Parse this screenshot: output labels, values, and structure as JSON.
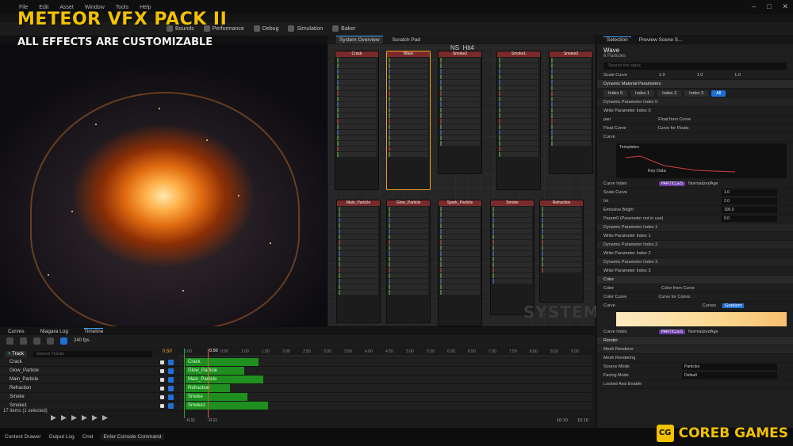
{
  "overlay": {
    "title": "METEOR VFX PACK II",
    "subtitle": "ALL EFFECTS ARE CUSTOMIZABLE"
  },
  "menubar": [
    "File",
    "Edit",
    "Asset",
    "Window",
    "Tools",
    "Help"
  ],
  "toolbar": {
    "bounds": "Bounds",
    "performance": "Performance",
    "debug": "Debug",
    "simulation": "Simulation",
    "baker": "Baker"
  },
  "graph": {
    "tabs": [
      "System Overview",
      "Scratch Pad"
    ],
    "system_name": "NS_Hit4",
    "watermark": "SYSTEM",
    "top_nodes": [
      "Crack",
      "Wave",
      "Smoke2",
      "Smoke1",
      "Smoke3"
    ],
    "bottom_nodes": [
      "Main_Particle",
      "Glow_Particle",
      "Spark_Particle",
      "Smoke",
      "Refraction"
    ]
  },
  "details": {
    "tabs": [
      "Selection",
      "Preview Scene S..."
    ],
    "name": "Wave",
    "subtitle": "6 Particles",
    "search_placeholder": "Search the stack",
    "scale_curve": "Scale Curve",
    "dynamic_params": "Dynamic Material Parameters",
    "index_pills": [
      "Index 0",
      "Index 1",
      "Index 2",
      "Index 3",
      "All"
    ],
    "dyn_index0": "Dynamic Parameter Index 0",
    "write_index0": "Write Parameter Index 0",
    "param_0": "pari",
    "float_from_curve": "Float from Curve",
    "float_curve": "Float Curve",
    "curve_for_floats": "Curve for Floats",
    "curve": "Curve",
    "templates": "Templates",
    "key_data": "Key Data",
    "curve_index": "Curve Index",
    "particles_tag": "PARTICLES",
    "normalized_age": "NormalizedAge",
    "scale_curve_value": "1.0",
    "rows_values": [
      {
        "label": "Int",
        "value": "2.0"
      },
      {
        "label": "Emissive Bright",
        "value": "100.0"
      },
      {
        "label": "Param0 (Parameter not in use)",
        "value": "0.0"
      }
    ],
    "dyn_index1": "Dynamic Parameter Index 1",
    "write_index1": "Write Parameter Index 1",
    "dyn_index2": "Dynamic Parameter Index 2",
    "write_index2": "Write Parameter Index 2",
    "dyn_index3": "Dynamic Parameter Index 3",
    "write_index3": "Write Parameter Index 3",
    "color_section": "Color",
    "color_label": "Color",
    "color_from_curve": "Color from Curve",
    "color_curve": "Color Curve",
    "curve_for_colors": "Curve for Colors",
    "curves_tab": "Curves",
    "gradient_tab": "Gradient",
    "render_section": "Render",
    "mesh_renderer": "Mesh Renderer",
    "mesh_rendering": "Mesh Rendering",
    "source_mode": "Source Mode",
    "source_mode_val": "Particles",
    "facing_mode": "Facing Mode",
    "facing_mode_val": "Default",
    "locked_axis": "Locked Axis Enable",
    "xyz": {
      "x": "1.0",
      "y": "1.0",
      "z": "1.0"
    }
  },
  "bottom": {
    "tabs": [
      "Curves",
      "Niagara Log",
      "Timeline"
    ],
    "fps": "240 fps",
    "add_track": "Track",
    "search_tracks": "Search Tracks",
    "playhead_value": "0.50",
    "left_start": "0.00",
    "ruler_labels": [
      "0.00",
      "0.50",
      "1.00",
      "1.50",
      "2.00",
      "2.50",
      "3.00",
      "3.50",
      "4.00",
      "4.50",
      "5.00",
      "5.50",
      "6.00",
      "6.50",
      "7.00",
      "7.50",
      "8.00",
      "8.50",
      "9.00",
      "9.50"
    ],
    "tracks": [
      "Crack",
      "Glow_Particle",
      "Main_Particle",
      "Refraction",
      "Smoke",
      "Smoke1"
    ],
    "count": "17 items (1 selected)",
    "foot_left": "-0.11",
    "foot_left2": "-0.11",
    "foot_right": "10.10",
    "foot_right2": "10.10"
  },
  "status": {
    "content_drawer": "Content Drawer",
    "output_log": "Output Log",
    "cmd": "Cmd",
    "cmd_placeholder": "Enter Console Command"
  },
  "brand": {
    "logo": "CG",
    "name": "COREB GAMES"
  },
  "colors": {
    "accent": "#f2c200",
    "track_green": "#1f8f1f",
    "selection_blue": "#1f6fd6"
  }
}
